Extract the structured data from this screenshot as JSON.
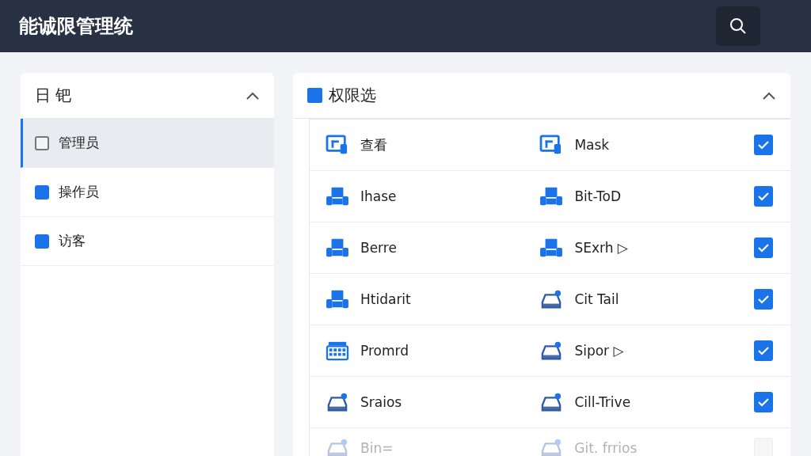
{
  "window": {
    "title": "能诚限管理统"
  },
  "roles": {
    "title": "日 钯",
    "expanded": true,
    "items": [
      {
        "label": "管理员",
        "selected": true,
        "checked": false
      },
      {
        "label": "操作员",
        "selected": false,
        "checked": true
      },
      {
        "label": "访客",
        "selected": false,
        "checked": true
      }
    ]
  },
  "permissions": {
    "title": "权限选",
    "expanded": true,
    "rows": [
      {
        "left": {
          "kind": "monitor",
          "label": "查看"
        },
        "right": {
          "kind": "monitor",
          "label": "Mask"
        },
        "checked": true,
        "disabled": false
      },
      {
        "left": {
          "kind": "desk",
          "label": "Ihase"
        },
        "right": {
          "kind": "desk",
          "label": "Bit-ToD"
        },
        "checked": true,
        "disabled": false
      },
      {
        "left": {
          "kind": "desk",
          "label": "Berre"
        },
        "right": {
          "kind": "desk",
          "label": "SExrh ▷"
        },
        "checked": true,
        "disabled": false
      },
      {
        "left": {
          "kind": "desk",
          "label": "Htidarit"
        },
        "right": {
          "kind": "tray",
          "label": "Cit Tail"
        },
        "checked": true,
        "disabled": false
      },
      {
        "left": {
          "kind": "grid",
          "label": "Promrd"
        },
        "right": {
          "kind": "tray",
          "label": "Sipor ▷"
        },
        "checked": true,
        "disabled": false
      },
      {
        "left": {
          "kind": "tray",
          "label": "Sraios"
        },
        "right": {
          "kind": "tray",
          "label": "Cill-Trive"
        },
        "checked": true,
        "disabled": false
      },
      {
        "left": {
          "kind": "tray",
          "label": "Bin="
        },
        "right": {
          "kind": "tray",
          "label": "Git. frrios"
        },
        "checked": false,
        "disabled": true
      }
    ]
  }
}
